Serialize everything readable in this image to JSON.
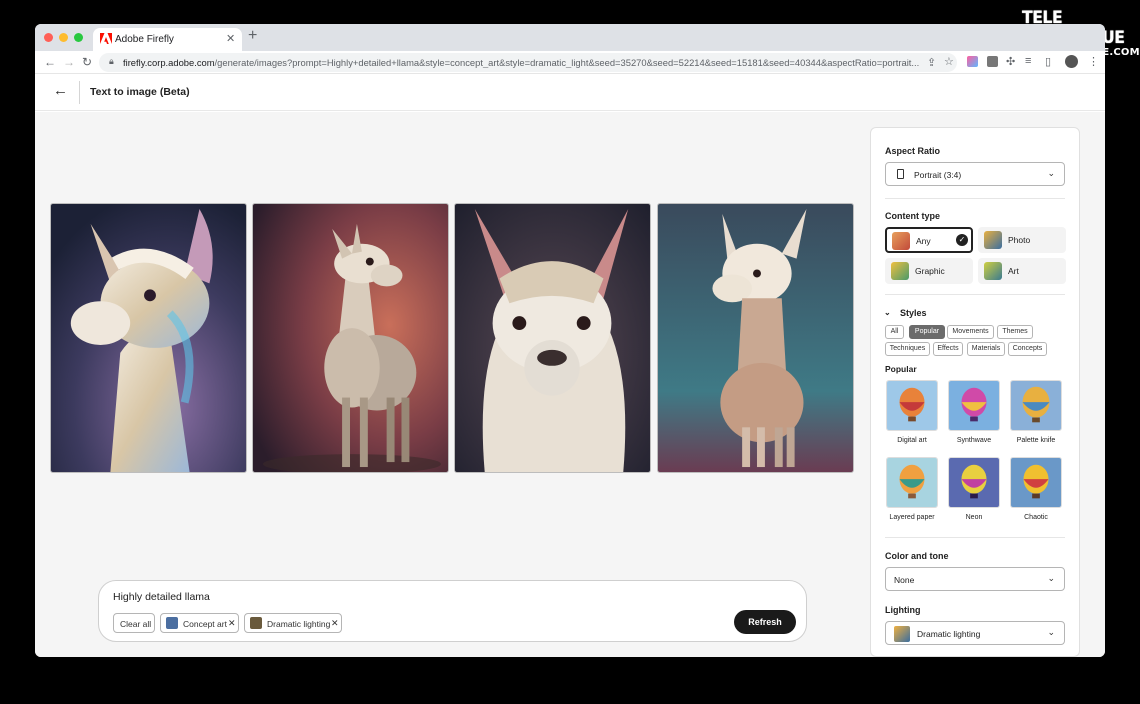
{
  "watermark": {
    "line1": "TELE NUMERIQUE",
    "line2": "TELESATELLITE.COM"
  },
  "browser": {
    "tab_title": "Adobe Firefly",
    "url_host": "firefly.corp.adobe.com",
    "url_path": "/generate/images?prompt=Highly+detailed+llama&style=concept_art&style=dramatic_light&seed=35270&seed=52214&seed=15181&seed=40344&aspectRatio=portrait..."
  },
  "app": {
    "title": "Text to image (Beta)"
  },
  "prompt": {
    "text": "Highly detailed llama",
    "clear_label": "Clear all",
    "chips": [
      "Concept art",
      "Dramatic lighting"
    ],
    "refresh_label": "Refresh"
  },
  "panel": {
    "aspect_ratio": {
      "title": "Aspect Ratio",
      "value": "Portrait (3:4)"
    },
    "content_type": {
      "title": "Content type",
      "options": [
        "Any",
        "Photo",
        "Graphic",
        "Art"
      ],
      "selected": "Any"
    },
    "styles": {
      "title": "Styles",
      "tags": [
        "All",
        "Popular",
        "Movements",
        "Themes",
        "Techniques",
        "Effects",
        "Materials",
        "Concepts"
      ],
      "active_tag": "Popular",
      "section_title": "Popular",
      "items": [
        "Digital art",
        "Synthwave",
        "Palette knife",
        "Layered paper",
        "Neon",
        "Chaotic"
      ]
    },
    "color_tone": {
      "title": "Color and tone",
      "value": "None"
    },
    "lighting": {
      "title": "Lighting",
      "value": "Dramatic lighting"
    }
  },
  "colors": {
    "accent": "#1a1a1a",
    "adobe_red": "#fa0f00"
  }
}
